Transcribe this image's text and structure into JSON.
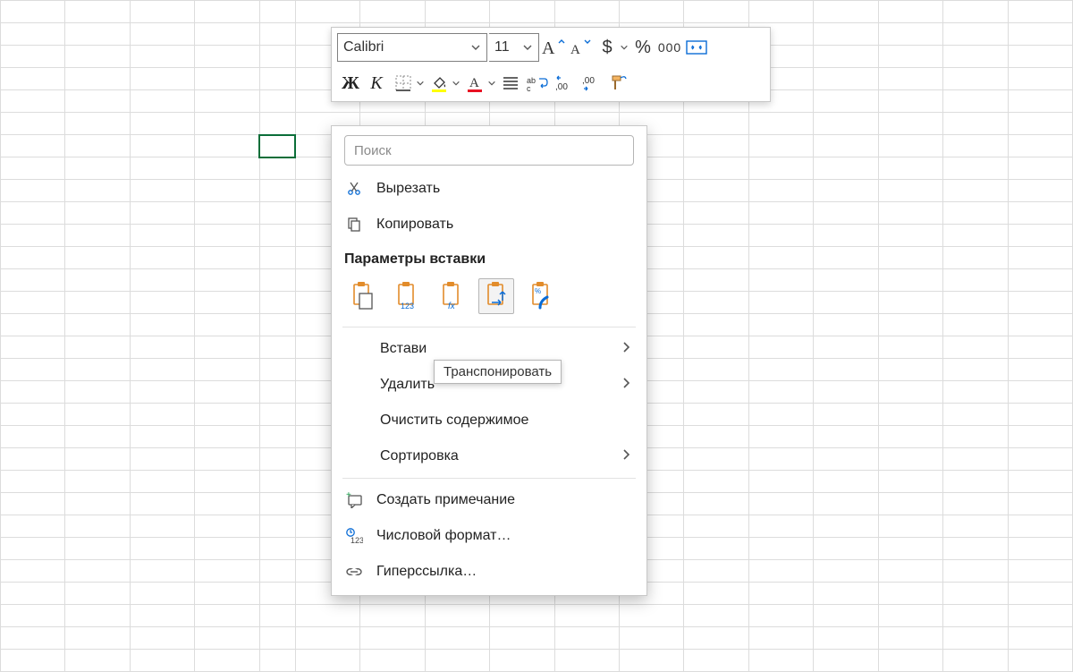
{
  "toolbar": {
    "font_name": "Calibri",
    "font_size": "11"
  },
  "ctx": {
    "search_placeholder": "Поиск",
    "cut": "Вырезать",
    "copy": "Копировать",
    "paste_head": "Параметры вставки",
    "insert": "Встави",
    "delete": "Удалить",
    "clear": "Очистить содержимое",
    "sort": "Сортировка",
    "comment": "Создать примечание",
    "numfmt": "Числовой формат…",
    "link": "Гиперссылка…"
  },
  "tooltip": "Транспонировать"
}
